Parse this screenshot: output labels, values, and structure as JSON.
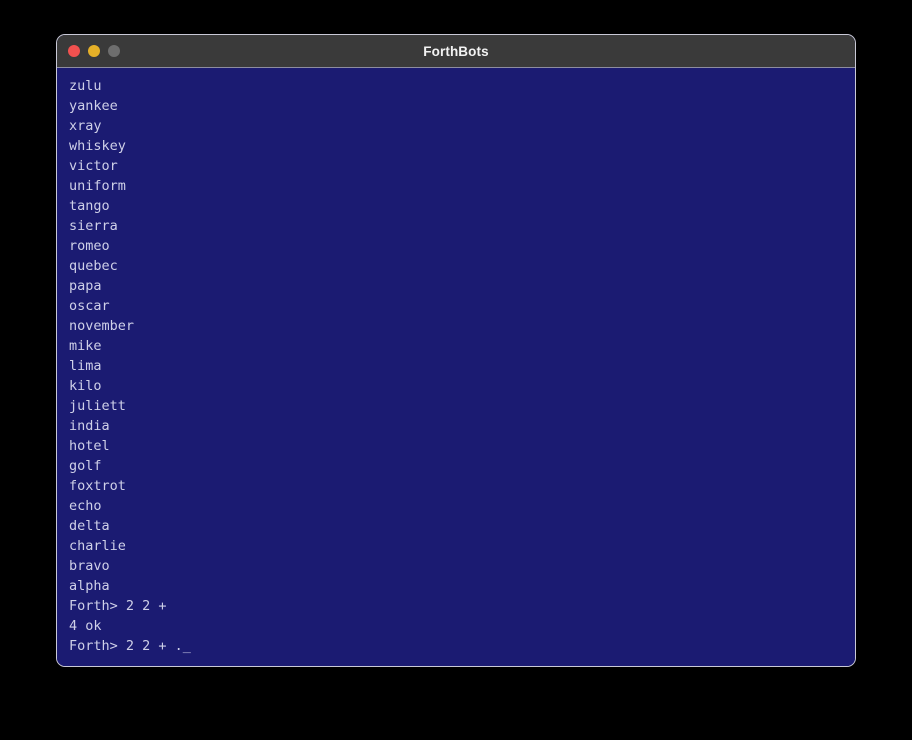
{
  "window": {
    "title": "ForthBots",
    "traffic_lights": [
      {
        "name": "close",
        "color": "#f1514f"
      },
      {
        "name": "minimize",
        "color": "#e5b028"
      },
      {
        "name": "maximize",
        "color": "#6e6e6e"
      }
    ]
  },
  "theme": {
    "desktop_background": "#000000",
    "titlebar_background": "#3a3a3a",
    "terminal_background": "#1b1b72",
    "terminal_foreground": "#cfd0e8",
    "window_border": "#c9c9d6"
  },
  "terminal": {
    "lines": [
      "zulu",
      "yankee",
      "xray",
      "whiskey",
      "victor",
      "uniform",
      "tango",
      "sierra",
      "romeo",
      "quebec",
      "papa",
      "oscar",
      "november",
      "mike",
      "lima",
      "kilo",
      "juliett",
      "india",
      "hotel",
      "golf",
      "foxtrot",
      "echo",
      "delta",
      "charlie",
      "bravo",
      "alpha",
      "Forth> 2 2 +",
      "4 ok",
      "Forth> 2 2 + ._"
    ]
  }
}
